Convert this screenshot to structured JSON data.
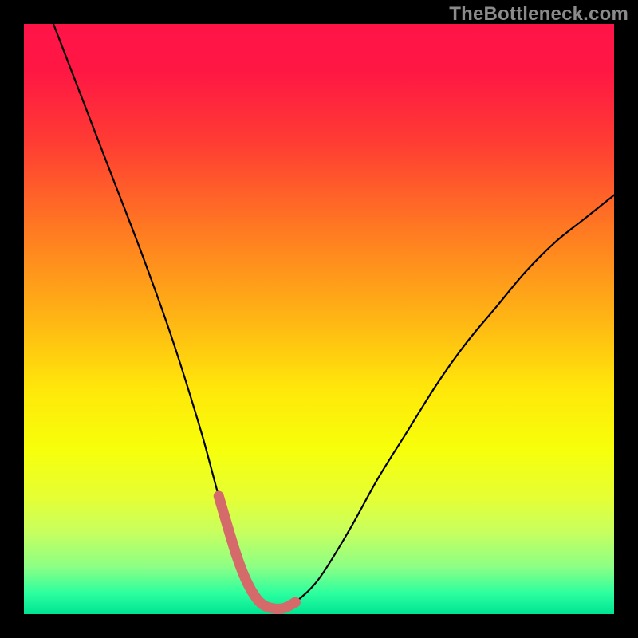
{
  "watermark": "TheBottleneck.com",
  "colors": {
    "bg": "#000000",
    "gradient_stops": [
      {
        "offset": 0.0,
        "color": "#ff1448"
      },
      {
        "offset": 0.08,
        "color": "#ff1744"
      },
      {
        "offset": 0.2,
        "color": "#ff3c33"
      },
      {
        "offset": 0.35,
        "color": "#ff7a22"
      },
      {
        "offset": 0.5,
        "color": "#ffb514"
      },
      {
        "offset": 0.62,
        "color": "#ffe80a"
      },
      {
        "offset": 0.72,
        "color": "#f7ff0a"
      },
      {
        "offset": 0.8,
        "color": "#e6ff33"
      },
      {
        "offset": 0.86,
        "color": "#c8ff5e"
      },
      {
        "offset": 0.92,
        "color": "#8dff85"
      },
      {
        "offset": 0.965,
        "color": "#2bff9f"
      },
      {
        "offset": 1.0,
        "color": "#00e493"
      }
    ],
    "curve": "#000000",
    "highlight": "#d46a6a"
  },
  "chart_data": {
    "type": "line",
    "title": "",
    "xlabel": "",
    "ylabel": "",
    "xlim": [
      0,
      100
    ],
    "ylim": [
      0,
      100
    ],
    "series": [
      {
        "name": "bottleneck-curve",
        "x": [
          5,
          10,
          15,
          20,
          25,
          30,
          33,
          36,
          38,
          40,
          42,
          44,
          46,
          50,
          55,
          60,
          65,
          70,
          75,
          80,
          85,
          90,
          95,
          100
        ],
        "y": [
          100,
          87,
          74,
          61,
          47,
          31,
          20,
          10,
          5,
          2,
          1,
          1,
          2,
          6,
          14,
          23,
          31,
          39,
          46,
          52,
          58,
          63,
          67,
          71
        ]
      }
    ],
    "highlight_range_x": [
      33,
      49
    ],
    "notes": "y is percent bottleneck (0 at bottom, 100 at top); color gradient vertical red→green encodes same value"
  }
}
